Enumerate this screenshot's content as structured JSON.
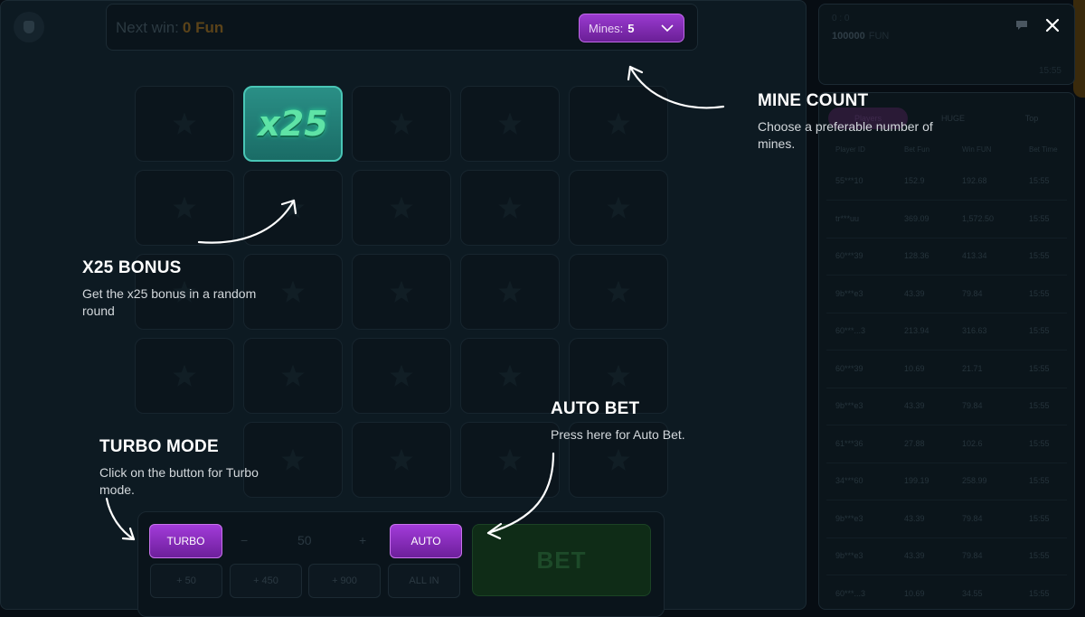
{
  "game": {
    "next_win_label": "Next win:",
    "next_win_value": "0 Fun",
    "mines_label": "Mines:",
    "mines_value": "5",
    "bonus_tile_text": "x25"
  },
  "controls": {
    "turbo_label": "TURBO",
    "stepper_minus": "−",
    "stepper_value": "50",
    "stepper_plus": "+",
    "auto_label": "AUTO",
    "bet_label": "BET",
    "chips": [
      "+ 50",
      "+ 450",
      "+ 900",
      "ALL IN"
    ]
  },
  "right_top": {
    "label": "0 : 0",
    "amount": "100000",
    "currency": "FUN",
    "time": "15:55"
  },
  "bets_panel": {
    "tabs": [
      "Players",
      "HUGE",
      "Top"
    ],
    "columns": [
      "Player ID",
      "Bet Fun",
      "Win FUN",
      "Bet Time"
    ],
    "rows": [
      [
        "55***10",
        "152.9",
        "192.68",
        "15:55"
      ],
      [
        "tr***uu",
        "369.09",
        "1,572.50",
        "15:55"
      ],
      [
        "60***39",
        "128.36",
        "413.34",
        "15:55"
      ],
      [
        "9b***e3",
        "43.39",
        "79.84",
        "15:55"
      ],
      [
        "60***...3",
        "213.94",
        "316.63",
        "15:55"
      ],
      [
        "60***39",
        "10.69",
        "21.71",
        "15:55"
      ],
      [
        "9b***e3",
        "43.39",
        "79.84",
        "15:55"
      ],
      [
        "61***36",
        "27.88",
        "102.6",
        "15:55"
      ],
      [
        "34***60",
        "199.19",
        "258.99",
        "15:55"
      ],
      [
        "9b***e3",
        "43.39",
        "79.84",
        "15:55"
      ],
      [
        "9b***e3",
        "43.39",
        "79.84",
        "15:55"
      ],
      [
        "60***...3",
        "10.69",
        "34.55",
        "15:55"
      ]
    ]
  },
  "tutorial": {
    "mine_count_title": "MINE COUNT",
    "mine_count_desc": "Choose a preferable number of mines.",
    "bonus_title": "X25 BONUS",
    "bonus_desc": "Get the x25 bonus in a random round",
    "auto_title": "AUTO BET",
    "auto_desc": "Press here for Auto Bet.",
    "turbo_title": "TURBO MODE",
    "turbo_desc": "Click on the button for Turbo mode."
  },
  "colors": {
    "accent_purple": "#8a2fc0",
    "bonus_teal": "#2a8f86",
    "bet_green": "#0f2c17",
    "background": "#0d1a22"
  },
  "icons": [
    "shield-icon",
    "chevron-down-icon",
    "star-icon",
    "chat-icon",
    "close-icon"
  ]
}
